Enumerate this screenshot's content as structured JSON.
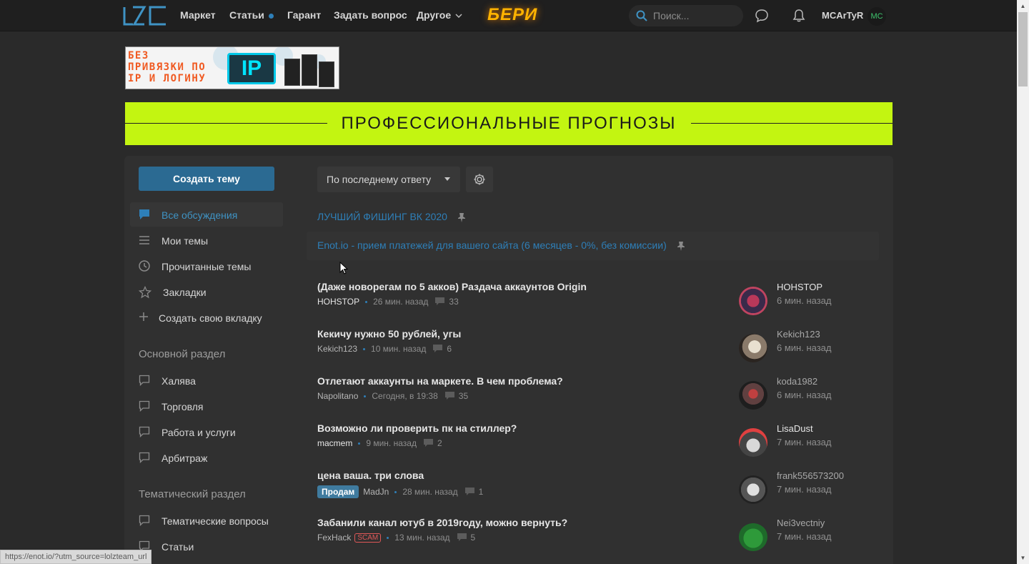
{
  "nav": {
    "market": "Маркет",
    "articles": "Статьи",
    "guarantor": "Гарант",
    "ask": "Задать вопрос",
    "other": "Другое",
    "promo": "БЕРИ",
    "search_placeholder": "Поиск...",
    "username": "MCArTyR",
    "avatar_initials": "MC"
  },
  "ads": {
    "small_lines": [
      "БЕЗ",
      "ПРИВЯЗКИ ПО",
      "IP И ЛОГИНУ"
    ],
    "small_logo": "IP",
    "big_text": "ПРОФЕССИОНАЛЬНЫЕ ПРОГНОЗЫ"
  },
  "sidebar": {
    "create_button": "Создать тему",
    "items": [
      {
        "label": "Все обсуждения",
        "active": true
      },
      {
        "label": "Мои темы"
      },
      {
        "label": "Прочитанные темы"
      },
      {
        "label": "Закладки"
      },
      {
        "label": "Создать свою вкладку"
      }
    ],
    "section_main": "Основной раздел",
    "main_items": [
      "Халява",
      "Торговля",
      "Работа и услуги",
      "Арбитраж"
    ],
    "section_thematic": "Тематический раздел",
    "thematic_items": [
      "Тематические вопросы",
      "Статьи"
    ]
  },
  "filters": {
    "sort_label": "По последнему ответу"
  },
  "sticky": [
    "ЛУЧШИЙ ФИШИНГ ВК 2020",
    "Enot.io - прием платежей для вашего сайта (6 месяцев - 0%, без комиссии)"
  ],
  "threads": [
    {
      "title": "(Даже новорегам по 5 акков) Раздача аккаунтов Origin",
      "author": "HOHSTOP",
      "time": "26 мин. назад",
      "replies": "33",
      "last_user": "HOHSTOP",
      "last_time": "6 мин. назад"
    },
    {
      "title": "Кекичу нужно 50 рублей, угы",
      "author": "Kekich123",
      "time": "10 мин. назад",
      "replies": "6",
      "last_user": "Kekich123",
      "last_time": "6 мин. назад"
    },
    {
      "title": "Отлетают аккаунты на маркете. В чем проблема?",
      "author": "Napolitano",
      "time": "Сегодня, в 19:38",
      "replies": "35",
      "last_user": "koda1982",
      "last_time": "6 мин. назад"
    },
    {
      "title": "Возможно ли проверить пк на стиллер?",
      "author": "macmem",
      "time": "9 мин. назад",
      "replies": "2",
      "last_user": "LisaDust",
      "last_time": "7 мин. назад"
    },
    {
      "title": "цена ваша. три слова",
      "prefix": "Продам",
      "author": "MadJn",
      "time": "28 мин. назад",
      "replies": "1",
      "last_user": "frank556573200",
      "last_time": "7 мин. назад"
    },
    {
      "title": "Забанили канал ютуб в 2019году, можно вернуть?",
      "author": "FexHack",
      "badge": "SCAM",
      "time": "13 мин. назад",
      "replies": "5",
      "last_user": "Nei3vectniy",
      "last_time": "7 мин. назад"
    }
  ],
  "status_bar_url": "https://enot.io/?utm_source=lolzteam_url",
  "colors": {
    "accent": "#2e7fb8",
    "background": "#2a2a2a",
    "panel": "#303030",
    "ad_green": "#c3f511"
  }
}
